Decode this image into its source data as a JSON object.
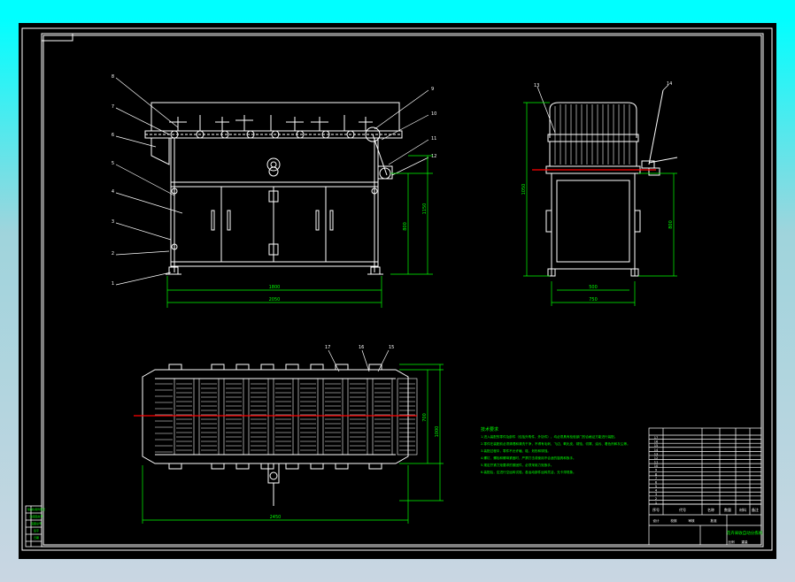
{
  "colors": {
    "sheet_bg": "#000000",
    "frame": "#ffffff",
    "dimension": "#00ff00",
    "center_line": "#ff0000",
    "note_text": "#00ff00",
    "title_text": "#00ff00",
    "label_text": "#ffff00"
  },
  "front_view": {
    "balloon_labels_left": [
      "8",
      "7",
      "6",
      "5",
      "4",
      "3",
      "2",
      "1"
    ],
    "balloon_labels_right": [
      "9",
      "10",
      "11",
      "12"
    ],
    "dims": {
      "inner_width": "1800",
      "overall_width": "2050",
      "table_height": "800",
      "total_height": "1150"
    }
  },
  "side_view": {
    "balloon_labels": [
      "13",
      "14"
    ],
    "dims": {
      "total_height": "1050",
      "leg_height": "800",
      "inner_width": "500",
      "overall_width": "750"
    }
  },
  "top_view": {
    "balloon_labels": [
      "17",
      "16",
      "15"
    ],
    "dims": {
      "overall_length": "2450",
      "inner_depth": "700",
      "overall_depth": "1000"
    }
  },
  "notes": {
    "heading": "技术要求",
    "lines": [
      "1.进入装配的零件及部件（包括外购件、外协件），均必须具有检验部门的合格证方能进行装配。",
      "2.零件在装配前必须清理和清洗干净，不得有毛刺、飞边、氧化皮、锈蚀、切屑、油污、着色剂和灰尘等。",
      "3.装配过程中，零件不允许磕、碰、划伤和锈蚀。",
      "4.螺钉、螺栓和螺母紧固时，严禁打击或使用不合适的旋具和扳手。",
      "5.规定拧紧力矩要求的紧固件，必须采用力矩扳手。",
      "6.装配后，应进行空运转试验，各运动部件运转灵活，无卡滞现象。"
    ]
  },
  "title_block": {
    "drawing_title": "花卉采收自动分拣机",
    "header_cells": [
      "序号",
      "代号",
      "名称",
      "数量",
      "材料",
      "备注"
    ],
    "rows": [
      "17",
      "16",
      "15",
      "14",
      "13",
      "12",
      "11",
      "10",
      "9",
      "8",
      "7",
      "6",
      "5",
      "4",
      "3",
      "2",
      "1"
    ],
    "footer": [
      "设计",
      "校核",
      "审核",
      "批准",
      "比例",
      "重量"
    ]
  },
  "side_strip": {
    "labels": [
      "借(通)用件登记",
      "旧底图总号",
      "底图总号",
      "签字",
      "日期"
    ]
  }
}
